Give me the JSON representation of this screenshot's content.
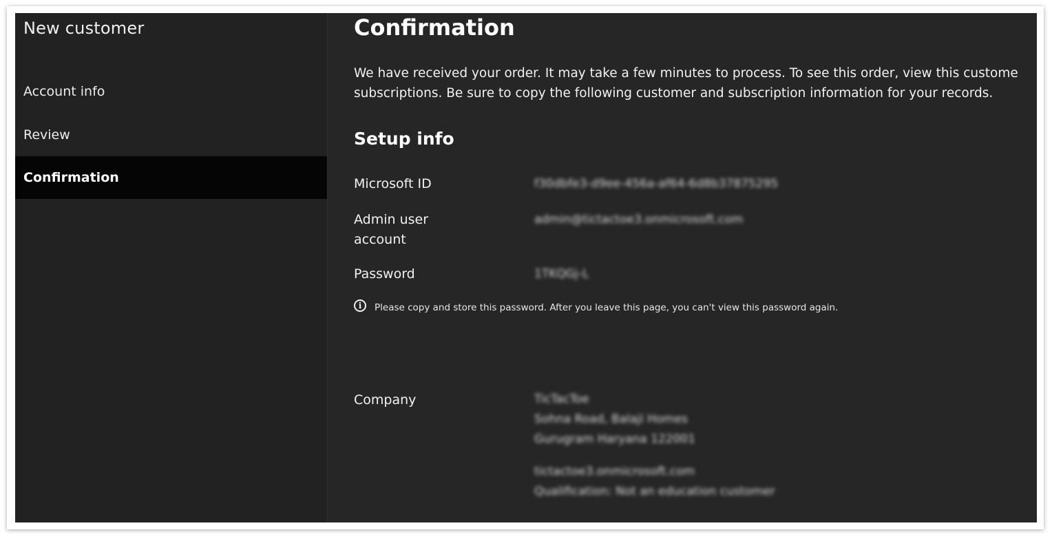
{
  "sidebar": {
    "title": "New customer",
    "items": [
      {
        "label": "Account info",
        "active": false
      },
      {
        "label": "Review",
        "active": false
      },
      {
        "label": "Confirmation",
        "active": true
      }
    ]
  },
  "main": {
    "title": "Confirmation",
    "intro_line1": "We have received your order. It may take a few minutes to process. To see this order, view this custome",
    "intro_line2": "subscriptions. Be sure to copy the following customer and subscription information for your records.",
    "setup_title": "Setup info",
    "fields": {
      "microsoft_id": {
        "label": "Microsoft ID",
        "value": "f30dbfe3-d9ee-456a-af64-6d8b37875295"
      },
      "admin_account": {
        "label": "Admin user account",
        "value": "admin@tictactoe3.onmicrosoft.com"
      },
      "password": {
        "label": "Password",
        "value": "1TKQGj-L"
      }
    },
    "notice_icon": "info-icon",
    "notice": "Please copy and store this password. After you leave this page, you can't view this password again.",
    "company": {
      "label": "Company",
      "name": "TicTacToe",
      "address_line1": "Sohna Road, Balaji Homes",
      "address_line2": "Gurugram Haryana 122001",
      "domain": "tictactoe3.onmicrosoft.com",
      "qualification": "Qualification: Not an education customer"
    }
  },
  "colors": {
    "sidebar_bg": "#222222",
    "active_item_bg": "#050505",
    "main_bg": "#262626",
    "text": "#ffffff"
  }
}
